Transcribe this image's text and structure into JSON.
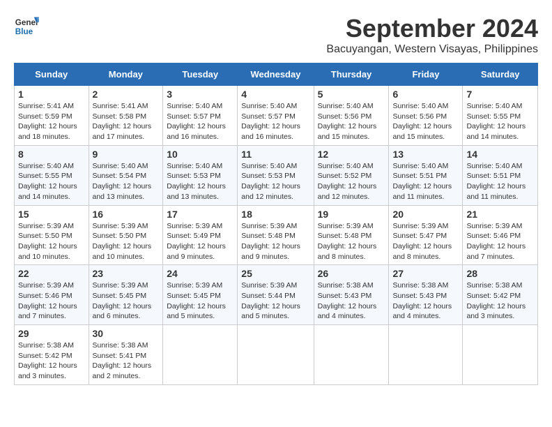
{
  "logo": {
    "line1": "General",
    "line2": "Blue"
  },
  "title": "September 2024",
  "subtitle": "Bacuyangan, Western Visayas, Philippines",
  "days_of_week": [
    "Sunday",
    "Monday",
    "Tuesday",
    "Wednesday",
    "Thursday",
    "Friday",
    "Saturday"
  ],
  "weeks": [
    [
      {
        "day": "1",
        "sunrise": "5:41 AM",
        "sunset": "5:59 PM",
        "daylight": "12 hours and 18 minutes."
      },
      {
        "day": "2",
        "sunrise": "5:41 AM",
        "sunset": "5:58 PM",
        "daylight": "12 hours and 17 minutes."
      },
      {
        "day": "3",
        "sunrise": "5:40 AM",
        "sunset": "5:57 PM",
        "daylight": "12 hours and 16 minutes."
      },
      {
        "day": "4",
        "sunrise": "5:40 AM",
        "sunset": "5:57 PM",
        "daylight": "12 hours and 16 minutes."
      },
      {
        "day": "5",
        "sunrise": "5:40 AM",
        "sunset": "5:56 PM",
        "daylight": "12 hours and 15 minutes."
      },
      {
        "day": "6",
        "sunrise": "5:40 AM",
        "sunset": "5:56 PM",
        "daylight": "12 hours and 15 minutes."
      },
      {
        "day": "7",
        "sunrise": "5:40 AM",
        "sunset": "5:55 PM",
        "daylight": "12 hours and 14 minutes."
      }
    ],
    [
      {
        "day": "8",
        "sunrise": "5:40 AM",
        "sunset": "5:55 PM",
        "daylight": "12 hours and 14 minutes."
      },
      {
        "day": "9",
        "sunrise": "5:40 AM",
        "sunset": "5:54 PM",
        "daylight": "12 hours and 13 minutes."
      },
      {
        "day": "10",
        "sunrise": "5:40 AM",
        "sunset": "5:53 PM",
        "daylight": "12 hours and 13 minutes."
      },
      {
        "day": "11",
        "sunrise": "5:40 AM",
        "sunset": "5:53 PM",
        "daylight": "12 hours and 12 minutes."
      },
      {
        "day": "12",
        "sunrise": "5:40 AM",
        "sunset": "5:52 PM",
        "daylight": "12 hours and 12 minutes."
      },
      {
        "day": "13",
        "sunrise": "5:40 AM",
        "sunset": "5:51 PM",
        "daylight": "12 hours and 11 minutes."
      },
      {
        "day": "14",
        "sunrise": "5:40 AM",
        "sunset": "5:51 PM",
        "daylight": "12 hours and 11 minutes."
      }
    ],
    [
      {
        "day": "15",
        "sunrise": "5:39 AM",
        "sunset": "5:50 PM",
        "daylight": "12 hours and 10 minutes."
      },
      {
        "day": "16",
        "sunrise": "5:39 AM",
        "sunset": "5:50 PM",
        "daylight": "12 hours and 10 minutes."
      },
      {
        "day": "17",
        "sunrise": "5:39 AM",
        "sunset": "5:49 PM",
        "daylight": "12 hours and 9 minutes."
      },
      {
        "day": "18",
        "sunrise": "5:39 AM",
        "sunset": "5:48 PM",
        "daylight": "12 hours and 9 minutes."
      },
      {
        "day": "19",
        "sunrise": "5:39 AM",
        "sunset": "5:48 PM",
        "daylight": "12 hours and 8 minutes."
      },
      {
        "day": "20",
        "sunrise": "5:39 AM",
        "sunset": "5:47 PM",
        "daylight": "12 hours and 8 minutes."
      },
      {
        "day": "21",
        "sunrise": "5:39 AM",
        "sunset": "5:46 PM",
        "daylight": "12 hours and 7 minutes."
      }
    ],
    [
      {
        "day": "22",
        "sunrise": "5:39 AM",
        "sunset": "5:46 PM",
        "daylight": "12 hours and 7 minutes."
      },
      {
        "day": "23",
        "sunrise": "5:39 AM",
        "sunset": "5:45 PM",
        "daylight": "12 hours and 6 minutes."
      },
      {
        "day": "24",
        "sunrise": "5:39 AM",
        "sunset": "5:45 PM",
        "daylight": "12 hours and 5 minutes."
      },
      {
        "day": "25",
        "sunrise": "5:39 AM",
        "sunset": "5:44 PM",
        "daylight": "12 hours and 5 minutes."
      },
      {
        "day": "26",
        "sunrise": "5:38 AM",
        "sunset": "5:43 PM",
        "daylight": "12 hours and 4 minutes."
      },
      {
        "day": "27",
        "sunrise": "5:38 AM",
        "sunset": "5:43 PM",
        "daylight": "12 hours and 4 minutes."
      },
      {
        "day": "28",
        "sunrise": "5:38 AM",
        "sunset": "5:42 PM",
        "daylight": "12 hours and 3 minutes."
      }
    ],
    [
      {
        "day": "29",
        "sunrise": "5:38 AM",
        "sunset": "5:42 PM",
        "daylight": "12 hours and 3 minutes."
      },
      {
        "day": "30",
        "sunrise": "5:38 AM",
        "sunset": "5:41 PM",
        "daylight": "12 hours and 2 minutes."
      },
      null,
      null,
      null,
      null,
      null
    ]
  ]
}
